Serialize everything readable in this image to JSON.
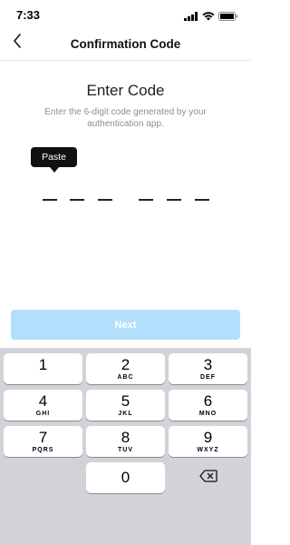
{
  "status_bar": {
    "time": "7:33"
  },
  "nav": {
    "title": "Confirmation Code"
  },
  "content": {
    "heading": "Enter Code",
    "subtitle": "Enter the 6-digit code generated by your authentication app."
  },
  "tooltip": {
    "label": "Paste"
  },
  "next_button": {
    "label": "Next",
    "background": "#b2dffc"
  },
  "keypad": {
    "keys": [
      {
        "number": "1",
        "letters": ""
      },
      {
        "number": "2",
        "letters": "ABC"
      },
      {
        "number": "3",
        "letters": "DEF"
      },
      {
        "number": "4",
        "letters": "GHI"
      },
      {
        "number": "5",
        "letters": "JKL"
      },
      {
        "number": "6",
        "letters": "MNO"
      },
      {
        "number": "7",
        "letters": "PQRS"
      },
      {
        "number": "8",
        "letters": "TUV"
      },
      {
        "number": "9",
        "letters": "WXYZ"
      },
      {
        "number": "0",
        "letters": ""
      }
    ]
  },
  "colors": {
    "keyboard_bg": "#d1d3d9",
    "accent_disabled": "#b2dffc"
  }
}
